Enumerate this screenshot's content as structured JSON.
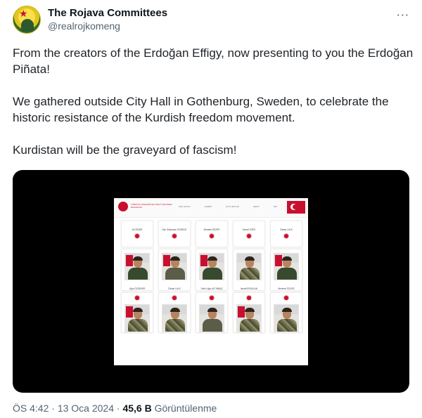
{
  "account": {
    "display_name": "The Rojava Committees",
    "handle": "@realrojkomeng",
    "more_icon": "more-dots-icon"
  },
  "tweet": {
    "paragraphs": [
      "From the creators of the Erdoğan Effigy, now presenting to you the Erdoğan Piñata!",
      "We gathered outside City Hall in Gothenburg, Sweden, to celebrate the historic resistance of the Kurdish freedom movement.",
      "Kurdistan will be the graveyard of fascism!"
    ]
  },
  "media": {
    "site_title": "TÜRKİYE CUMHURİYETİ MİLLÎ SAVUNMA BAKANLIĞI",
    "nav": [
      "ANA SAYFA",
      "HABER",
      "DUYURULAR",
      "ŞEHİT",
      "BİZ"
    ],
    "top_names": [
      "Ali DEMİR",
      "Eşe Süleyman GÜRECE",
      "Mustafa SEZER",
      "Kemal ÖZEK",
      "Özkan LALE"
    ],
    "mid_names": [
      "Uğur ÖZDEMİR",
      "Özkan LALE",
      "Fatih Uğur ALTINBAŞ",
      "İsmail ERASLAN",
      "Mehmet ÖZLER"
    ]
  },
  "footer": {
    "time": "ÖS 4:42",
    "date": "13 Oca 2024",
    "views": "45,6 B",
    "views_label": "Görüntülenme"
  }
}
